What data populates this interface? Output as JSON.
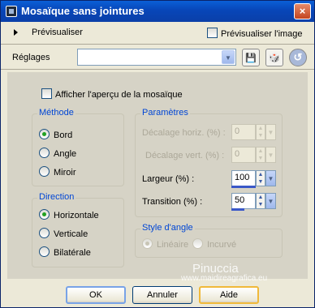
{
  "window": {
    "title": "Mosaïque sans jointures",
    "close_glyph": "×"
  },
  "preview_row": {
    "label": "Prévisualiser",
    "checkbox_label": "Prévisualiser l'image"
  },
  "reglages": {
    "label": "Réglages",
    "value": ""
  },
  "icons": {
    "dropdown": "▼",
    "save": "💾",
    "dice": "🎲",
    "reset": "↺",
    "up": "▲",
    "down": "▼"
  },
  "options": {
    "show_preview_label": "Afficher l'aperçu de la mosaïque"
  },
  "methode": {
    "legend": "Méthode",
    "items": [
      {
        "label": "Bord",
        "checked": true
      },
      {
        "label": "Angle",
        "checked": false
      },
      {
        "label": "Miroir",
        "checked": false
      }
    ]
  },
  "direction": {
    "legend": "Direction",
    "items": [
      {
        "label": "Horizontale",
        "checked": true
      },
      {
        "label": "Verticale",
        "checked": false
      },
      {
        "label": "Bilatérale",
        "checked": false
      }
    ]
  },
  "parametres": {
    "legend": "Paramètres",
    "rows": [
      {
        "label": "Décalage horiz. (%) :",
        "value": "0",
        "enabled": false
      },
      {
        "label": "Décalage vert. (%) :",
        "value": "0",
        "enabled": false
      },
      {
        "label": "Largeur (%) :",
        "value": "100",
        "enabled": true
      },
      {
        "label": "Transition (%) :",
        "value": "50",
        "enabled": true
      }
    ]
  },
  "style_angle": {
    "legend": "Style d'angle",
    "items": [
      {
        "label": "Linéaire",
        "checked": true
      },
      {
        "label": "Incurvé",
        "checked": false
      }
    ]
  },
  "buttons": {
    "ok": "OK",
    "cancel": "Annuler",
    "help": "Aide"
  },
  "watermark": {
    "name": "Pinuccia",
    "url": "www.maidireagrafica.eu"
  }
}
